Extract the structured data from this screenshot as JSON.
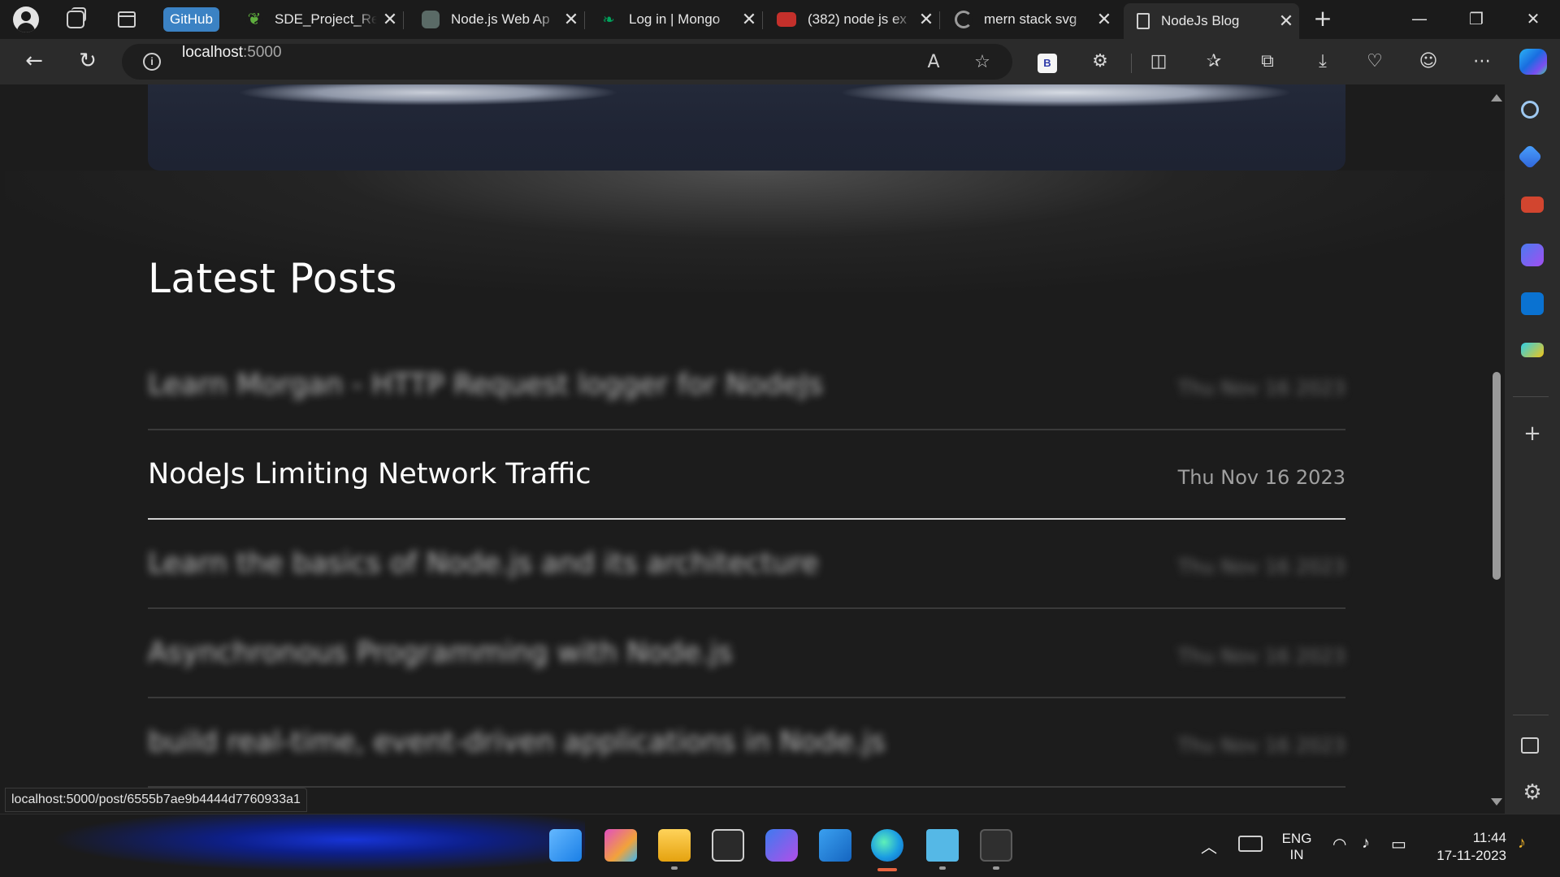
{
  "tabs": {
    "pinned_label": "GitHub",
    "items": [
      {
        "title": "SDE_Project_Re",
        "favicon_color": "#5fae3e"
      },
      {
        "title": "Node.js Web Ap",
        "favicon_color": "#6b6b6b"
      },
      {
        "title": "Log in | Mongo",
        "favicon_color": "#00684a"
      },
      {
        "title": "(382) node js ex",
        "favicon_color": "#e33b2e"
      },
      {
        "title": "mern stack svg",
        "favicon_color": "#8a8a8a"
      },
      {
        "title": "NodeJs Blog",
        "favicon_color": "#d0d0d0"
      }
    ],
    "close_glyph": "✕",
    "new_tab_glyph": "+"
  },
  "address_bar": {
    "host": "localhost",
    "port": ":5000"
  },
  "page": {
    "section_title": "Latest Posts",
    "posts": [
      {
        "title": "Learn Morgan - HTTP Request logger for NodeJs",
        "date": "Thu Nov 16 2023"
      },
      {
        "title": "NodeJs Limiting Network Traffic",
        "date": "Thu Nov 16 2023"
      },
      {
        "title": "Learn the basics of Node.js and its architecture",
        "date": "Thu Nov 16 2023"
      },
      {
        "title": "Asynchronous Programming with Node.js",
        "date": "Thu Nov 16 2023"
      },
      {
        "title": "build real-time, event-driven applications in Node.js",
        "date": "Thu Nov 16 2023"
      }
    ]
  },
  "status_bar": {
    "hover_url": "localhost:5000/post/6555b7ae9b4444d7760933a1"
  },
  "taskbar": {
    "language": "ENG",
    "region": "IN",
    "time": "11:44",
    "date": "17-11-2023"
  },
  "colors": {
    "page_background": "#1c1c1c",
    "accent_github": "#3b82c4",
    "active_app_indicator": "#e8633f"
  }
}
